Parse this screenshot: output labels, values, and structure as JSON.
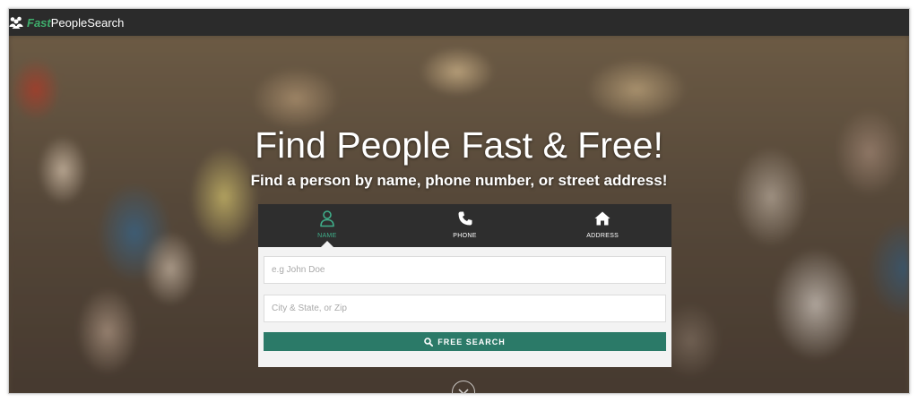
{
  "brand": {
    "fast": "Fast",
    "rest": "PeopleSearch"
  },
  "hero": {
    "title": "Find People Fast & Free!",
    "subtitle": "Find a person by name, phone number, or street address!"
  },
  "tabs": [
    {
      "label": "NAME",
      "icon": "person-icon",
      "active": true
    },
    {
      "label": "PHONE",
      "icon": "phone-icon",
      "active": false
    },
    {
      "label": "ADDRESS",
      "icon": "home-icon",
      "active": false
    }
  ],
  "form": {
    "name_placeholder": "e.g John Doe",
    "location_placeholder": "City & State, or Zip",
    "search_label": "FREE SEARCH"
  },
  "colors": {
    "brand_accent": "#3fae6c",
    "navbar": "#2b2b2b",
    "tab_active": "#3fae8a",
    "button": "#2b7a68"
  }
}
